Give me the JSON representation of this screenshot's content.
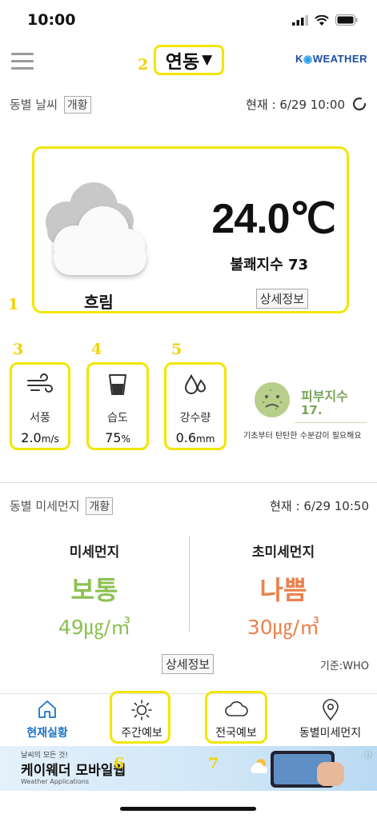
{
  "status_bar": {
    "time": "10:00"
  },
  "header": {
    "location": "연동",
    "location_arrow": "▼",
    "logo": {
      "part1": "K",
      "part2": "WEATHER"
    },
    "location_annotation": "2"
  },
  "current_weather": {
    "section_title": "동별 날씨",
    "overview_tag": "개황",
    "updated": "현재 : 6/29 10:00",
    "condition": "흐림",
    "temperature": "24.0℃",
    "discomfort_index": "불쾌지수 73",
    "detail_button": "상세정보",
    "card_annotation": "1"
  },
  "metrics": [
    {
      "annotation": "3",
      "icon": "wind-icon",
      "label": "서풍",
      "value": "2.0",
      "unit": "m/s"
    },
    {
      "annotation": "4",
      "icon": "humidity-cup-icon",
      "label": "습도",
      "value": "75",
      "unit": "%"
    },
    {
      "annotation": "5",
      "icon": "rain-drops-icon",
      "label": "강수량",
      "value": "0.6",
      "unit": "mm"
    }
  ],
  "skin_index": {
    "title": "피부지수",
    "value": "17.",
    "description": "기초부터 탄탄한 수분감이 필요해요",
    "face_color": "#b7cf8a"
  },
  "fine_dust": {
    "section_title": "동별 미세먼지",
    "overview_tag": "개황",
    "updated": "현재 : 6/29 10:50",
    "pm10": {
      "title": "미세먼지",
      "grade": "보통",
      "value": "49㎍/㎥",
      "color": "#8cc152"
    },
    "pm25": {
      "title": "초미세먼지",
      "grade": "나쁨",
      "value": "30㎍/㎥",
      "color": "#e8834e"
    },
    "detail_button": "상세정보",
    "standard": "기준:WHO"
  },
  "tab_bar": {
    "tabs": [
      {
        "label": "현재실황",
        "icon": "home-icon",
        "active": true
      },
      {
        "label": "주간예보",
        "icon": "sun-icon",
        "active": false
      },
      {
        "label": "전국예보",
        "icon": "cloud-icon",
        "active": false
      },
      {
        "label": "동별미세먼지",
        "icon": "location-pin-icon",
        "active": false
      }
    ],
    "annotations": [
      "6",
      "7"
    ]
  },
  "ad": {
    "small": "날씨의 모든 것!",
    "main": "케이웨더 모바일웹",
    "sub": "Weather Applications"
  },
  "colors": {
    "accent": "#1a73c8",
    "highlight": "#f2e600",
    "skin": "#7aa55a"
  }
}
